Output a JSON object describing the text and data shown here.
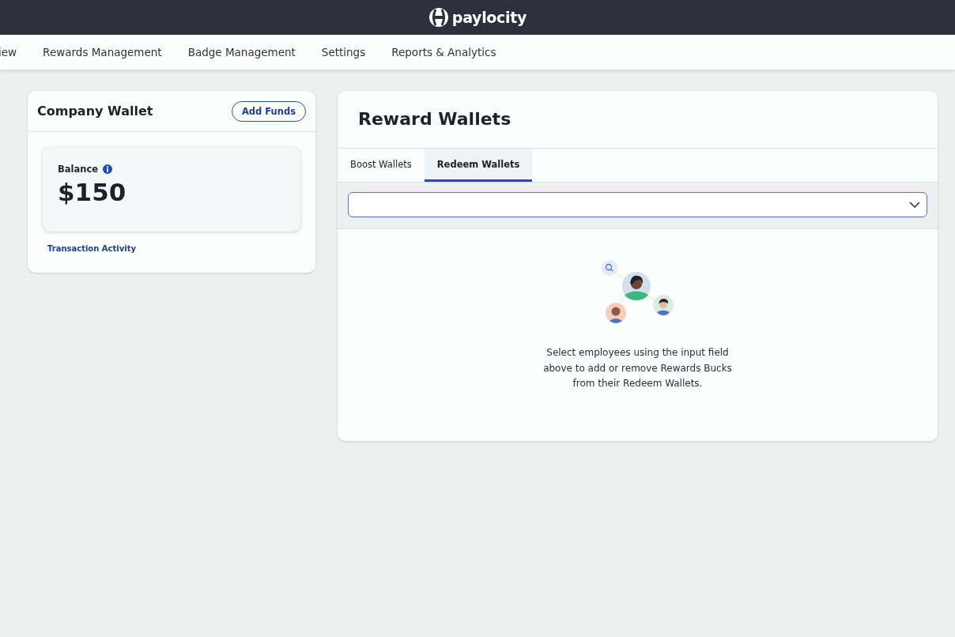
{
  "header": {
    "logo_text": "paylocity"
  },
  "nav": [
    {
      "label": "iew"
    },
    {
      "label": "Rewards Management"
    },
    {
      "label": "Badge Management"
    },
    {
      "label": "Settings"
    },
    {
      "label": "Reports & Analytics"
    }
  ],
  "company_wallet": {
    "title": "Company Wallet",
    "add_button": "Add Funds",
    "balance_label": "Balance",
    "balance": "$150",
    "link": "Transaction Activity"
  },
  "reward_wallets": {
    "title": "Reward Wallets",
    "tabs": [
      {
        "label": "Boost Wallets",
        "selected": false
      },
      {
        "label": "Redeem Wallets",
        "selected": true
      }
    ],
    "empty_message": "Select employees using the input field above to add or remove Rewards Bucks from their Redeem Wallets."
  }
}
